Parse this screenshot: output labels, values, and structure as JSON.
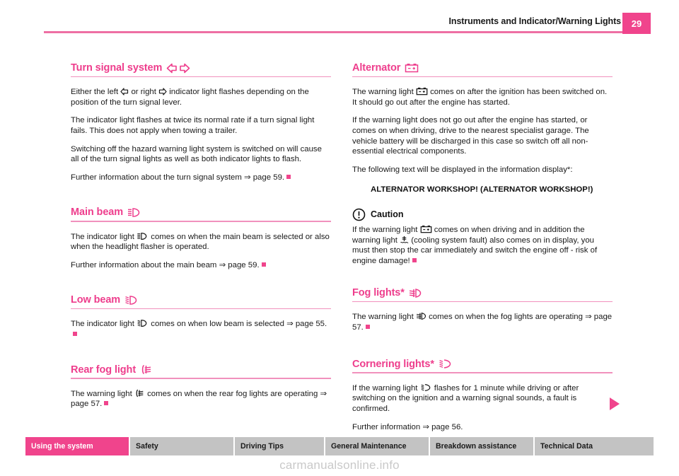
{
  "header": {
    "title": "Instruments and Indicator/Warning Lights",
    "page_number": "29"
  },
  "colors": {
    "accent_pink": "#f0448c",
    "heading_pink": "#ee3d8c",
    "rule_pink": "#f191bd",
    "tab_gray": "#c3c3c3"
  },
  "left_column": {
    "sections": [
      {
        "id": "turn-signal-system",
        "heading": "Turn signal system",
        "heading_icon": "turn-signal-double-arrow-icon",
        "paragraphs": [
          "Either the left ⇦ or right ⇨ indicator light flashes depending on the position of the turn signal lever.",
          "The indicator light flashes at twice its normal rate if a turn signal light fails. This does not apply when towing a trailer.",
          "Switching off the hazard warning light system is switched on will cause all of the turn signal lights as well as both indicator lights to flash.",
          "Further information about the turn signal system ⇒ page 59."
        ],
        "p1_part1": "Either the left",
        "p1_part2": "or right",
        "p1_part3": "indicator light flashes depending on the position of the turn signal lever.",
        "p2": "The indicator light flashes at twice its normal rate if a turn signal light fails. This does not apply when towing a trailer.",
        "p3": "Switching off the hazard warning light system is switched on will cause all of the turn signal lights as well as both indicator lights to flash.",
        "p4": "Further information about the turn signal system ⇒ page 59."
      },
      {
        "id": "main-beam",
        "heading": "Main beam",
        "heading_icon": "main-beam-icon",
        "p1_part1": "The indicator light",
        "p1_part2": "comes on when the main beam is selected or also when the headlight flasher is operated.",
        "p2": "Further information about the main beam ⇒ page 59."
      },
      {
        "id": "low-beam",
        "heading": "Low beam",
        "heading_icon": "low-beam-icon",
        "p1_part1": "The indicator light",
        "p1_part2": "comes on when low beam is selected ⇒ page 55."
      },
      {
        "id": "rear-fog-light",
        "heading": "Rear fog light",
        "heading_icon": "rear-fog-light-icon",
        "p1_part1": "The warning light",
        "p1_part2": "comes on when the rear fog lights are operating ⇒ page 57."
      }
    ]
  },
  "right_column": {
    "sections": [
      {
        "id": "alternator",
        "heading": "Alternator",
        "heading_icon": "battery-icon",
        "p1_part1": "The warning light",
        "p1_part2": "comes on after the ignition has been switched on. It should go out after the engine has started.",
        "p2": "If the warning light does not go out after the engine has started, or comes on when driving, drive to the nearest specialist garage. The vehicle battery will be discharged in this case so switch off all non-essential electrical components.",
        "p3": "The following text will be displayed in the information display*:",
        "display_text": "ALTERNATOR WORKSHOP! (ALTERNATOR WORKSHOP!)",
        "caution": {
          "icon": "caution-exclamation-icon",
          "label": "Caution",
          "part1": "If the warning light",
          "part2": "comes on when driving and in addition the warning light",
          "part3": "(cooling system fault) also comes on in display, you must then stop the car immediately and switch the engine off - risk of engine damage!"
        }
      },
      {
        "id": "fog-lights",
        "heading": "Fog lights*",
        "heading_icon": "fog-light-icon",
        "p1_part1": "The warning light",
        "p1_part2": "comes on when the fog lights are operating ⇒ page 57."
      },
      {
        "id": "cornering-lights",
        "heading": "Cornering lights*",
        "heading_icon": "cornering-light-icon",
        "p1_part1": "If the warning light",
        "p1_part2": "flashes for 1 minute while driving or after switching on the ignition and a warning signal sounds, a fault is confirmed.",
        "p2": "Further information ⇒ page 56."
      }
    ]
  },
  "footer": {
    "tabs": [
      {
        "label": "Using the system",
        "active": true
      },
      {
        "label": "Safety",
        "active": false
      },
      {
        "label": "Driving Tips",
        "active": false
      },
      {
        "label": "General Maintenance",
        "active": false
      },
      {
        "label": "Breakdown assistance",
        "active": false
      },
      {
        "label": "Technical Data",
        "active": false
      }
    ]
  },
  "watermark": "carmanualsonline.info"
}
